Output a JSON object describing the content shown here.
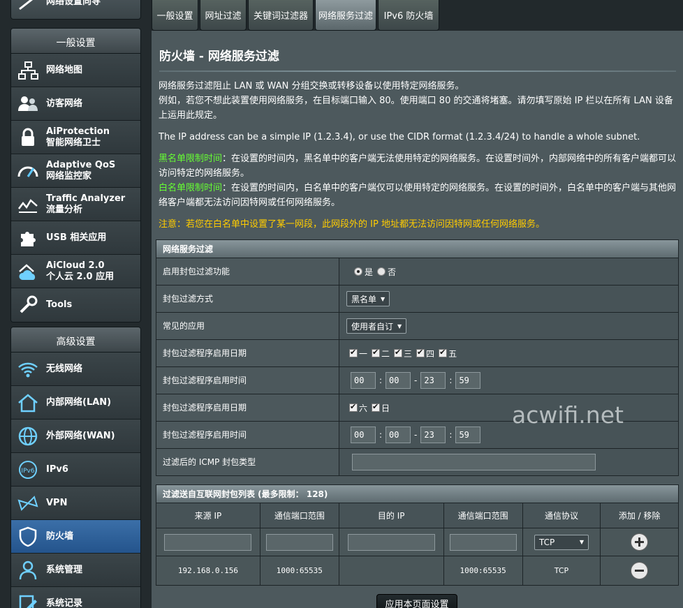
{
  "sidebar": {
    "top_stub_label": "网络设置向导",
    "general_header": "一般设置",
    "general_items": [
      {
        "label": "网络地图",
        "label2": ""
      },
      {
        "label": "访客网络",
        "label2": ""
      },
      {
        "label": "AiProtection",
        "label2": "智能网络卫士"
      },
      {
        "label": "Adaptive QoS",
        "label2": "网络监控家"
      },
      {
        "label": "Traffic Analyzer",
        "label2": "流量分析"
      },
      {
        "label": "USB 相关应用",
        "label2": ""
      },
      {
        "label": "AiCloud 2.0",
        "label2": "个人云 2.0 应用"
      },
      {
        "label": "Tools",
        "label2": ""
      }
    ],
    "advanced_header": "高级设置",
    "advanced_items": [
      {
        "label": "无线网络"
      },
      {
        "label": "内部网络(LAN)"
      },
      {
        "label": "外部网络(WAN)"
      },
      {
        "label": "IPv6"
      },
      {
        "label": "VPN"
      },
      {
        "label": "防火墙"
      },
      {
        "label": "系统管理"
      },
      {
        "label": "系统记录"
      }
    ]
  },
  "tabs": [
    "一般设置",
    "网址过滤",
    "关键词过滤器",
    "网络服务过滤",
    "IPv6 防火墙"
  ],
  "page": {
    "title": "防火墙 - 网络服务过滤",
    "desc1": "网络服务过滤阻止 LAN 或 WAN 分组交换或转移设备以使用特定网络服务。",
    "desc2": "例如，若您不想此装置使用网络服务，在目标端口输入 80。使用端口 80 的交通将堵塞。请勿填写原始 IP 栏以在所有 LAN 设备上运用此规定。",
    "desc3": "The IP address can be a simple IP (1.2.3.4), or use the CIDR format (1.2.3.4/24) to handle a whole subnet.",
    "blacklist_label": "黑名单限制时间",
    "blacklist_text": "：在设置的时间内，黑名单中的客户端无法使用特定的网络服务。在设置时间外，内部网络中的所有客户端都可以访问特定的网络服务。",
    "whitelist_label": "白名单限制时间",
    "whitelist_text": "：在设置的时间内，白名单中的客户端仅可以使用特定的网络服务。在设置的时间外，白名单中的客户端与其他网络客户端都无法访问因特网或任何网络服务。",
    "note": "注意：若您在白名单中设置了某一网段，此网段外的 IP 地址都无法访问因特网或任何网络服务。"
  },
  "filter_section": {
    "header": "网络服务过滤",
    "enable_label": "启用封包过滤功能",
    "yes": "是",
    "no": "否",
    "method_label": "封包过滤方式",
    "method_value": "黑名单",
    "app_label": "常见的应用",
    "app_value": "使用者自订",
    "date1_label": "封包过滤程序启用日期",
    "weekdays": [
      "一",
      "二",
      "三",
      "四",
      "五"
    ],
    "time1_label": "封包过滤程序启用时间",
    "time1": [
      "00",
      "00",
      "23",
      "59"
    ],
    "date2_label": "封包过滤程序启用日期",
    "weekend": [
      "六",
      "日"
    ],
    "time2_label": "封包过滤程序启用时间",
    "time2": [
      "00",
      "00",
      "23",
      "59"
    ],
    "icmp_label": "过滤后的 ICMP 封包类型"
  },
  "list_section": {
    "header": "过滤送自互联网封包列表 (最多限制： 128)",
    "columns": [
      "来源 IP",
      "通信端口范围",
      "目的 IP",
      "通信端口范围",
      "通信协议",
      "添加 / 移除"
    ],
    "input_protocol": "TCP",
    "rows": [
      {
        "src_ip": "192.168.0.156",
        "src_port": "1000:65535",
        "dst_ip": "",
        "dst_port": "1000:65535",
        "protocol": "TCP"
      }
    ]
  },
  "apply_label": "应用本页面设置",
  "watermark": "acwifi.net"
}
